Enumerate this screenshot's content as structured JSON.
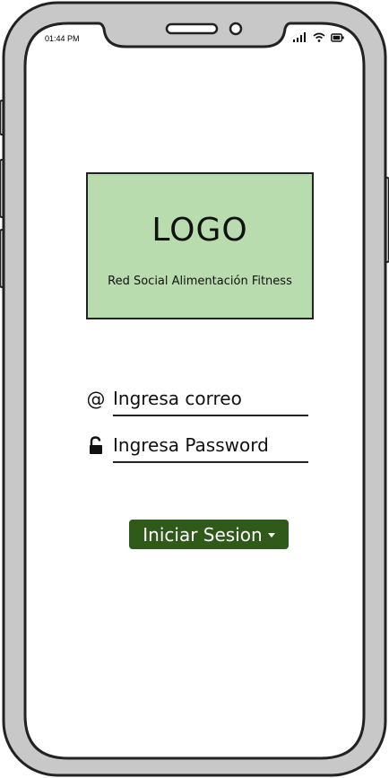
{
  "status_bar": {
    "time": "01:44 PM",
    "icons": [
      "signal-icon",
      "wifi-icon",
      "battery-icon"
    ]
  },
  "logo": {
    "title": "LOGO",
    "subtitle": "Red Social Alimentación Fitness",
    "background": "#b9dcae"
  },
  "form": {
    "email": {
      "icon": "at-sign-icon",
      "icon_glyph": "@",
      "placeholder": "Ingresa correo",
      "value": ""
    },
    "password": {
      "icon": "unlocked-padlock-icon",
      "placeholder": "Ingresa Password",
      "value": ""
    }
  },
  "login_button": {
    "label": "Iniciar Sesion",
    "background": "#2f5a1a"
  }
}
